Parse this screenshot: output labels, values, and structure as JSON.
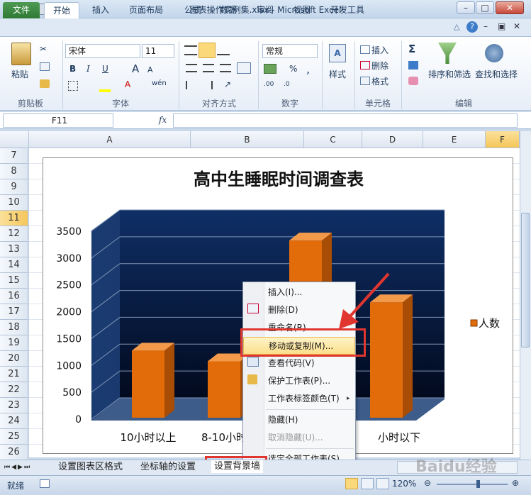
{
  "window": {
    "title": "图表操作实例集.xlsx - Microsoft Excel"
  },
  "ribbon_tabs": [
    "文件",
    "开始",
    "插入",
    "页面布局",
    "公式",
    "数据",
    "审阅",
    "视图",
    "开发工具"
  ],
  "clipboard": {
    "paste": "粘贴",
    "label": "剪贴板"
  },
  "font": {
    "name": "宋体",
    "size": "11",
    "bold": "B",
    "italic": "I",
    "underline": "U",
    "label": "字体",
    "grow": "A",
    "shrink": "A",
    "color_letter": "A",
    "pinyin": "wén"
  },
  "alignment": {
    "label": "对齐方式"
  },
  "number": {
    "format": "常规",
    "percent": "%",
    "comma": ",",
    "label": "数字"
  },
  "styles": {
    "label": "样式"
  },
  "cells": {
    "insert": "插入",
    "delete": "删除",
    "format": "格式",
    "label": "单元格"
  },
  "editing": {
    "sigma": "Σ",
    "sort": "排序和筛选",
    "find": "查找和选择",
    "label": "编辑"
  },
  "formula_bar": {
    "name_box": "F11",
    "fx": "fx",
    "value": ""
  },
  "columns": [
    "A",
    "B",
    "C",
    "D",
    "E",
    "F"
  ],
  "rows": [
    "7",
    "8",
    "9",
    "10",
    "11",
    "12",
    "13",
    "14",
    "15",
    "16",
    "17",
    "18",
    "19",
    "20",
    "21",
    "22",
    "23",
    "24",
    "25",
    "26"
  ],
  "chart_data": {
    "type": "bar",
    "title": "高中生睡眠时间调查表",
    "categories": [
      "10小时以上",
      "8-10小时",
      "",
      "小时以下"
    ],
    "series": [
      {
        "name": "人数",
        "values": [
          1250,
          1050,
          3300,
          2150
        ]
      }
    ],
    "ylim": [
      0,
      3500
    ],
    "yticks": [
      "0",
      "500",
      "1000",
      "1500",
      "2000",
      "2500",
      "3000",
      "3500"
    ],
    "legend_position": "right",
    "colors": {
      "bar": "#e36c0a",
      "wall": "#0f2f66"
    }
  },
  "context_menu": [
    {
      "label": "插入(I)...",
      "disabled": false
    },
    {
      "label": "删除(D)",
      "disabled": false
    },
    {
      "label": "重命名(R)",
      "disabled": false
    },
    {
      "label": "移动或复制(M)...",
      "disabled": false,
      "highlighted": true
    },
    {
      "label": "查看代码(V)",
      "disabled": false
    },
    {
      "label": "保护工作表(P)...",
      "disabled": false
    },
    {
      "label": "工作表标签颜色(T)",
      "disabled": false
    },
    {
      "label": "隐藏(H)",
      "disabled": false
    },
    {
      "label": "取消隐藏(U)...",
      "disabled": true
    },
    {
      "label": "选定全部工作表(S)",
      "disabled": false
    }
  ],
  "sheet_tabs": [
    "设置图表区格式",
    "坐标轴的设置",
    "设置背景墙"
  ],
  "status": {
    "ready": "就绪",
    "zoom": "120%"
  },
  "watermark": "Baidu经验"
}
